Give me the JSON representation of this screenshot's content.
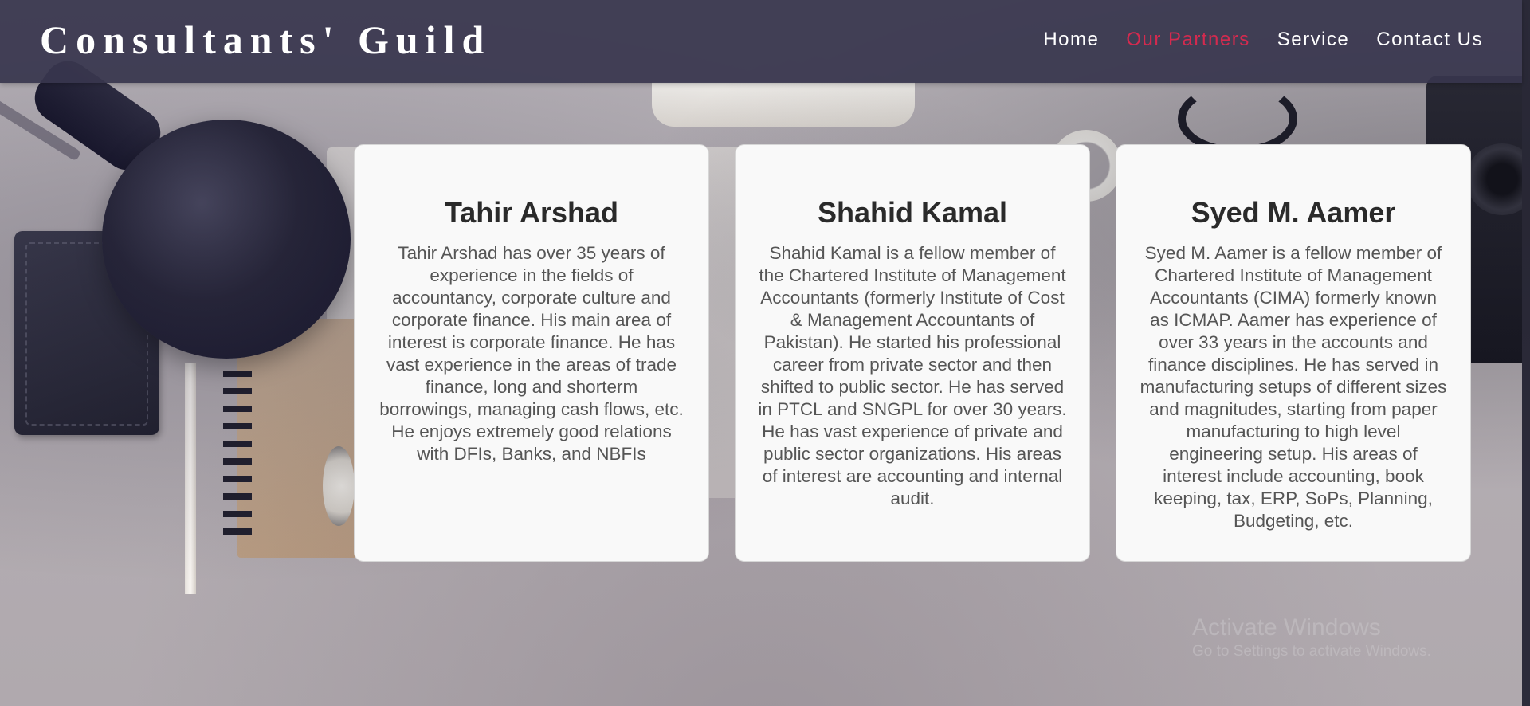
{
  "header": {
    "brand": "Consultants' Guild",
    "nav": [
      {
        "label": "Home",
        "active": false
      },
      {
        "label": "Our Partners",
        "active": true
      },
      {
        "label": "Service",
        "active": false
      },
      {
        "label": "Contact Us",
        "active": false
      }
    ],
    "active_color": "#d42a4f"
  },
  "partners": [
    {
      "name": "Tahir Arshad",
      "bio": "Tahir Arshad has over 35 years of experience in the fields of accountancy, corporate culture and corporate finance. His main area of interest is corporate finance. He has vast experience in the areas of trade finance, long and shorterm borrowings, managing cash flows, etc. He enjoys extremely good relations with DFIs, Banks, and NBFIs"
    },
    {
      "name": "Shahid Kamal",
      "bio": "Shahid Kamal is a fellow member of the Chartered Institute of Management Accountants (formerly Institute of Cost & Management Accountants of Pakistan). He started his professional career from private sector and then shifted to public sector. He has served in PTCL and SNGPL for over 30 years. He has vast experience of private and public sector organizations. His areas of interest are accounting and internal audit."
    },
    {
      "name": "Syed M. Aamer",
      "bio": "Syed M. Aamer is a fellow member of Chartered Institute of Management Accountants (CIMA) formerly known as ICMAP. Aamer has experience of over 33 years in the accounts and finance disciplines. He has served in manufacturing setups of different sizes and magnitudes, starting from paper manufacturing to high level engineering setup. His areas of interest include accounting, book keeping, tax, ERP, SoPs, Planning, Budgeting, etc."
    }
  ],
  "watermark": {
    "title": "Activate Windows",
    "subtitle": "Go to Settings to activate Windows."
  }
}
